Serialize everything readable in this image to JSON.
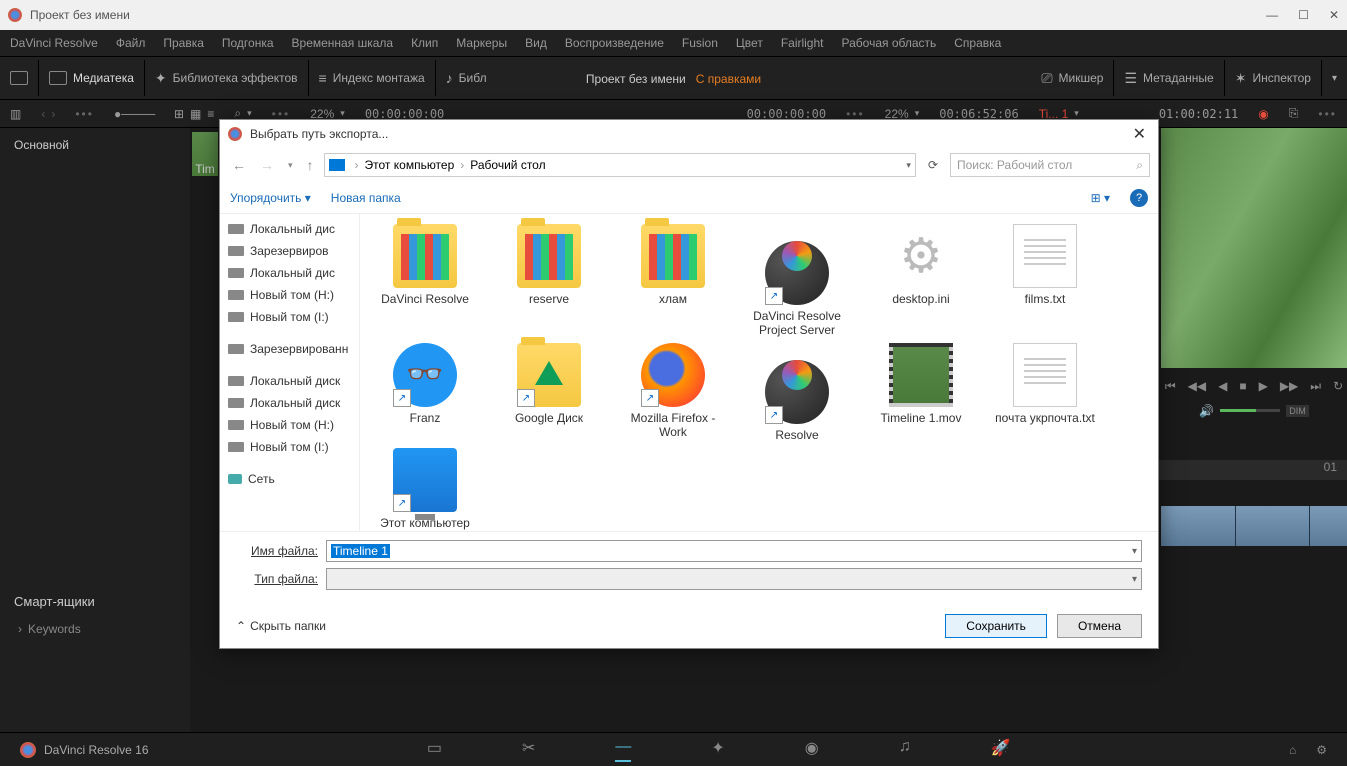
{
  "titlebar": {
    "title": "Проект без имени"
  },
  "menubar": [
    "DaVinci Resolve",
    "Файл",
    "Правка",
    "Подгонка",
    "Временная шкала",
    "Клип",
    "Маркеры",
    "Вид",
    "Воспроизведение",
    "Fusion",
    "Цвет",
    "Fairlight",
    "Рабочая область",
    "Справка"
  ],
  "toolbar": {
    "media": "Медиатека",
    "fx": "Библиотека эффектов",
    "index": "Индекс монтажа",
    "sound": "Библ",
    "center_title": "Проект без имени",
    "center_edits": "С правками",
    "mixer": "Микшер",
    "meta": "Метаданные",
    "inspector": "Инспектор"
  },
  "secondbar": {
    "zoom1": "22%",
    "tc1": "00:00:00:00",
    "tc2": "00:00:00:00",
    "zoom2": "22%",
    "tc3": "00:06:52:06",
    "timeline_label": "Ti... 1",
    "tc4": "01:00:02:11"
  },
  "leftpanel": {
    "tab": "Основной",
    "smart": "Смарт-ящики",
    "keywords": "Keywords"
  },
  "thumb_label": "Tim",
  "timeline_tick": "01",
  "volbadge": "DIM",
  "bottombar": {
    "app": "DaVinci Resolve 16"
  },
  "dialog": {
    "title": "Выбрать путь экспорта...",
    "breadcrumb": [
      "Этот компьютер",
      "Рабочий стол"
    ],
    "search_placeholder": "Поиск: Рабочий стол",
    "organize": "Упорядочить",
    "newfolder": "Новая папка",
    "tree": [
      "Локальный дис",
      "Зарезервиров",
      "Локальный дис",
      "Новый том (H:)",
      "Новый том (I:)",
      "Зарезервированн",
      "Локальный диск",
      "Локальный диск",
      "Новый том (H:)",
      "Новый том (I:)",
      "Сеть"
    ],
    "files": [
      {
        "name": "DaVinci Resolve",
        "type": "folder-content"
      },
      {
        "name": "reserve",
        "type": "folder-content"
      },
      {
        "name": "хлам",
        "type": "folder-content"
      },
      {
        "name": "DaVinci Resolve Project Server",
        "type": "resolve"
      },
      {
        "name": "desktop.ini",
        "type": "gear"
      },
      {
        "name": "films.txt",
        "type": "text"
      },
      {
        "name": "Franz",
        "type": "franz"
      },
      {
        "name": "Google Диск",
        "type": "gdrive"
      },
      {
        "name": "Mozilla Firefox - Work",
        "type": "firefox"
      },
      {
        "name": "Resolve",
        "type": "resolve"
      },
      {
        "name": "Timeline 1.mov",
        "type": "video"
      },
      {
        "name": "почта укрпочта.txt",
        "type": "text"
      },
      {
        "name": "Этот компьютер",
        "type": "pc"
      }
    ],
    "filename_label": "Имя файла:",
    "filename_value": "Timeline 1",
    "filetype_label": "Тип файла:",
    "hide_folders": "Скрыть папки",
    "save": "Сохранить",
    "cancel": "Отмена"
  }
}
